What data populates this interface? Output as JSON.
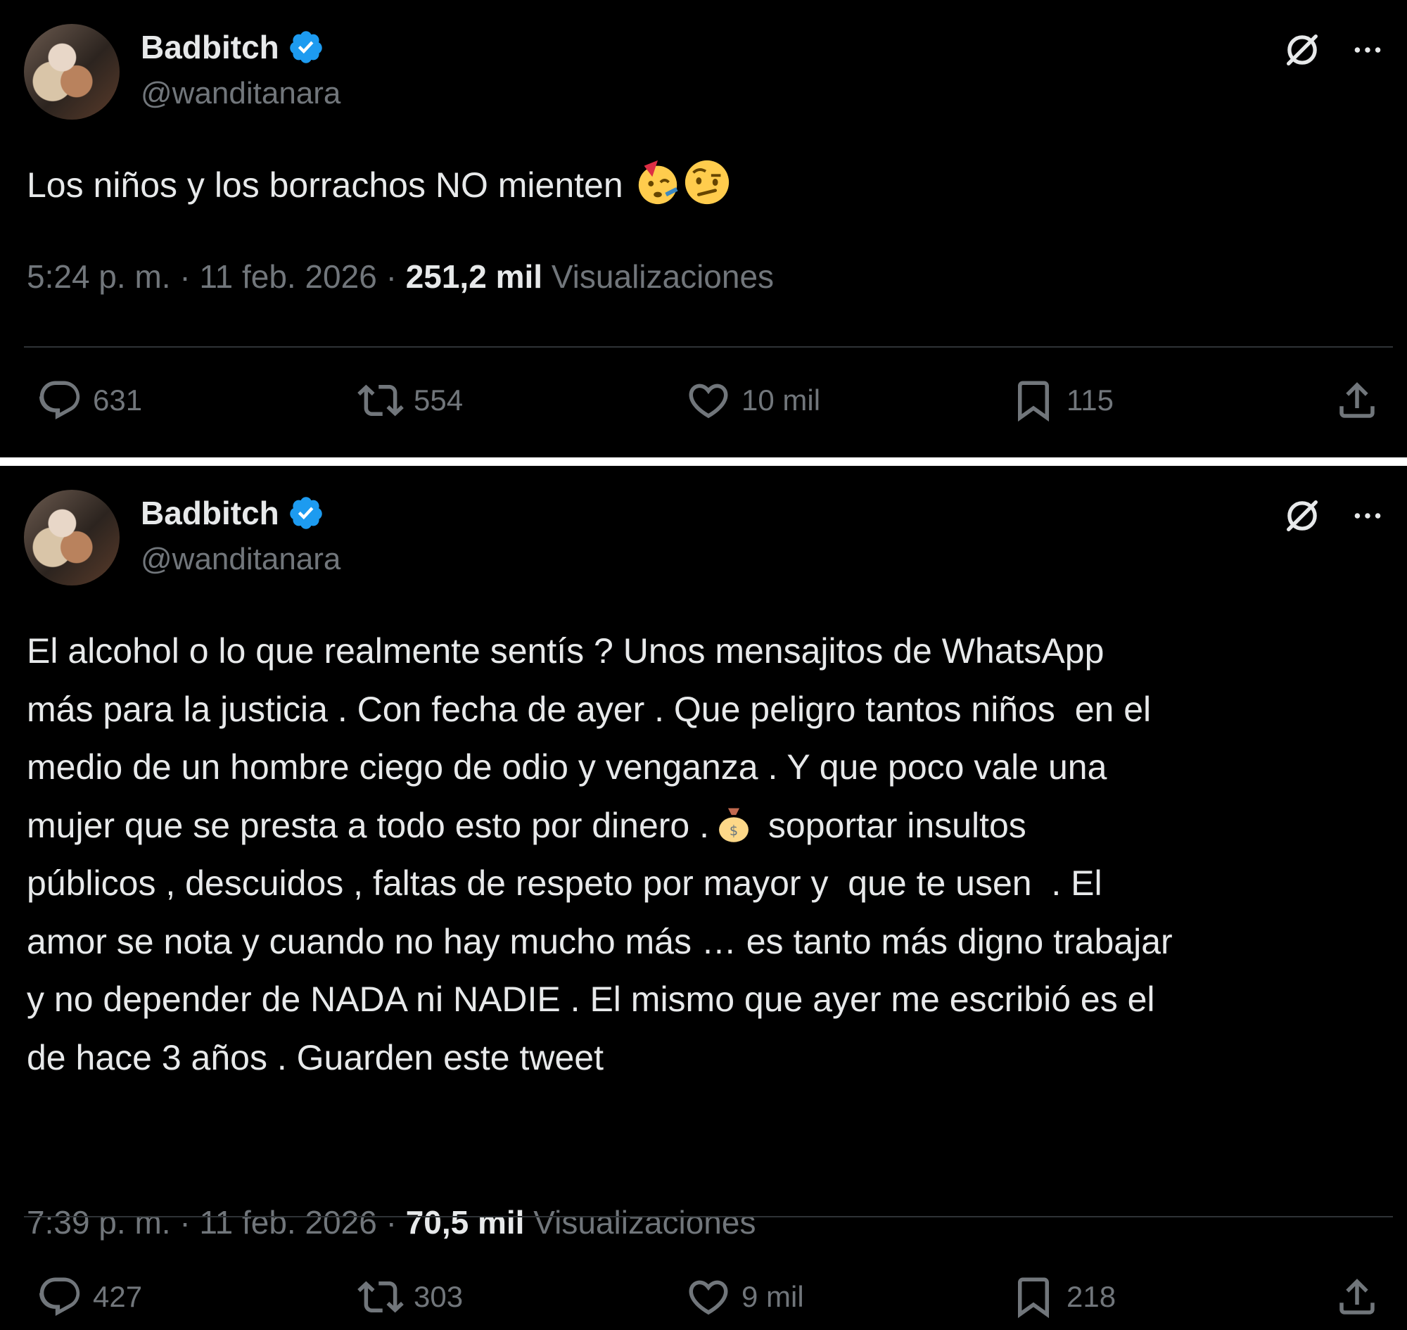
{
  "colors": {
    "background": "#000000",
    "text": "#e7e9ea",
    "muted": "#71767b",
    "verified": "#1d9bf0"
  },
  "tweets": [
    {
      "author": {
        "name": "Badbitch",
        "handle": "@wanditanara",
        "verified": true
      },
      "text": "Los niños y los borrachos NO mienten",
      "emojis": [
        "partying-face",
        "face-with-raised-eyebrow"
      ],
      "time": "5:24 p. m. · 11 feb. 2026 ·",
      "views": "251,2 mil",
      "views_label": "Visualizaciones",
      "stats": {
        "replies": "631",
        "reposts": "554",
        "likes": "10 mil",
        "bookmarks": "115"
      }
    },
    {
      "author": {
        "name": "Badbitch",
        "handle": "@wanditanara",
        "verified": true
      },
      "text_before_emoji": "El alcohol o lo que realmente sentís ? Unos mensajitos de WhatsApp\nmás para la justicia . Con fecha de ayer . Que peligro tantos niños  en el\nmedio de un hombre ciego de odio y venganza . Y que poco vale una\nmujer que se presta a todo esto por dinero .",
      "emoji": "money-bag",
      "text_after_emoji": " soportar insultos\npúblicos , descuidos , faltas de respeto por mayor y  que te usen  . El\namor se nota y cuando no hay mucho más … es tanto más digno trabajar\ny no depender de NADA ni NADIE . El mismo que ayer me escribió es el\nde hace 3 años . Guarden este tweet",
      "time": "7:39 p. m. · 11 feb. 2026 ·",
      "views": "70,5 mil",
      "views_label": "Visualizaciones",
      "stats": {
        "replies": "427",
        "reposts": "303",
        "likes": "9 mil",
        "bookmarks": "218"
      }
    }
  ]
}
